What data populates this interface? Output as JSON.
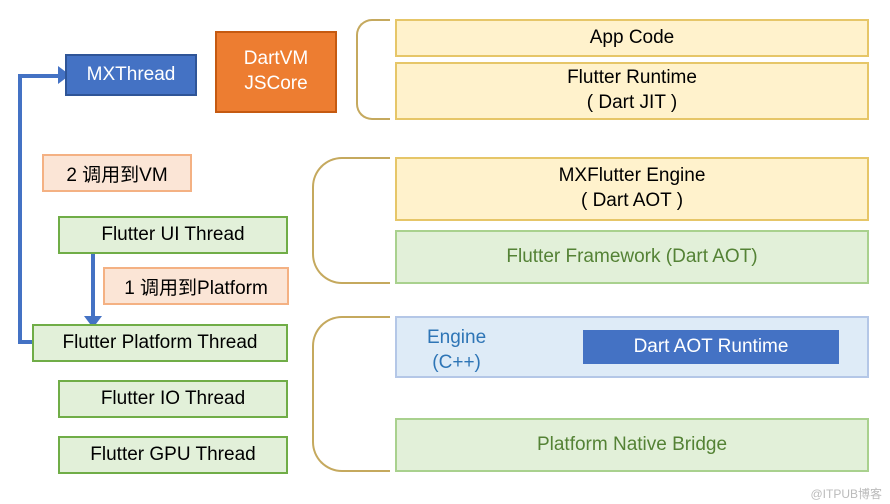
{
  "left": {
    "mxthread": "MXThread",
    "dartvm_l1": "DartVM",
    "dartvm_l2": "JSCore",
    "call2vm": "2 调用到VM",
    "call1platform": "1 调用到Platform",
    "ui_thread": "Flutter UI Thread",
    "platform_thread": "Flutter Platform Thread",
    "io_thread": "Flutter IO Thread",
    "gpu_thread": "Flutter GPU Thread"
  },
  "right": {
    "appcode": "App Code",
    "runtime_l1": "Flutter Runtime",
    "runtime_l2": "( Dart JIT )",
    "mxengine_l1": "MXFlutter Engine",
    "mxengine_l2": "( Dart AOT )",
    "framework": "Flutter Framework (Dart AOT)",
    "engine_l1": "Engine",
    "engine_l2": "(C++)",
    "aot_runtime": "Dart AOT Runtime",
    "native_bridge": "Platform Native Bridge"
  },
  "watermark": "@ITPUB博客"
}
